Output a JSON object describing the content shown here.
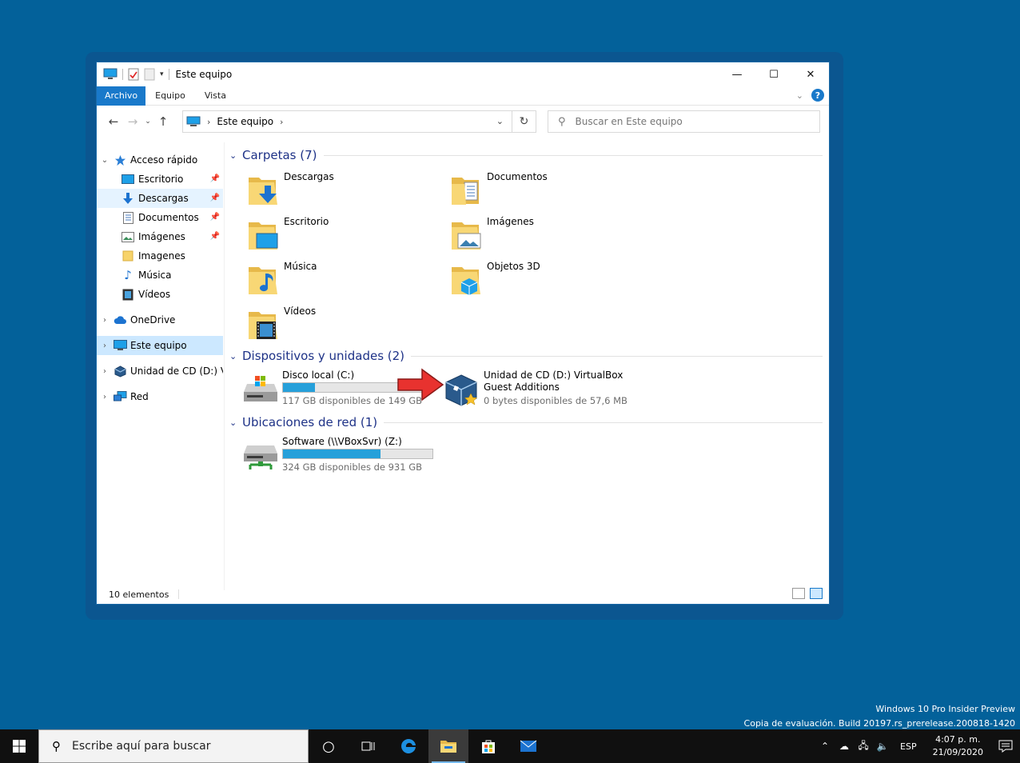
{
  "window": {
    "title": "Este equipo",
    "controls": {
      "minimize": "—",
      "maximize": "☐",
      "close": "✕"
    }
  },
  "ribbon": {
    "tabs": [
      {
        "label": "Archivo",
        "active": true
      },
      {
        "label": "Equipo",
        "active": false
      },
      {
        "label": "Vista",
        "active": false
      }
    ],
    "help": "?"
  },
  "address": {
    "location": "Este equipo",
    "separator": "›"
  },
  "search": {
    "placeholder": "Buscar en Este equipo"
  },
  "sidebar": {
    "items": [
      {
        "label": "Acceso rápido",
        "icon": "star-icon",
        "expander": "⌄",
        "pinned": false
      },
      {
        "label": "Escritorio",
        "icon": "desktop-icon",
        "expander": "",
        "pinned": true
      },
      {
        "label": "Descargas",
        "icon": "download-icon",
        "expander": "",
        "pinned": true
      },
      {
        "label": "Documentos",
        "icon": "document-icon",
        "expander": "",
        "pinned": true
      },
      {
        "label": "Imágenes",
        "icon": "pictures-icon",
        "expander": "",
        "pinned": true
      },
      {
        "label": "Imagenes",
        "icon": "folder-icon",
        "expander": "",
        "pinned": false
      },
      {
        "label": "Música",
        "icon": "music-icon",
        "expander": "",
        "pinned": false
      },
      {
        "label": "Vídeos",
        "icon": "video-icon",
        "expander": "",
        "pinned": false
      },
      {
        "label": "OneDrive",
        "icon": "cloud-icon",
        "expander": "›",
        "pinned": false
      },
      {
        "label": "Este equipo",
        "icon": "computer-icon",
        "expander": "›",
        "pinned": false
      },
      {
        "label": "Unidad de CD (D:) VirtualBox Guest Additions",
        "icon": "cd-drive-icon",
        "expander": "›",
        "pinned": false
      },
      {
        "label": "Red",
        "icon": "network-icon",
        "expander": "›",
        "pinned": false
      }
    ]
  },
  "groups": {
    "folders": {
      "title": "Carpetas (7)",
      "items": [
        {
          "label": "Descargas",
          "icon": "downloads-folder-icon"
        },
        {
          "label": "Documentos",
          "icon": "documents-folder-icon"
        },
        {
          "label": "Escritorio",
          "icon": "desktop-folder-icon"
        },
        {
          "label": "Imágenes",
          "icon": "pictures-folder-icon"
        },
        {
          "label": "Música",
          "icon": "music-folder-icon"
        },
        {
          "label": "Objetos 3D",
          "icon": "3d-objects-folder-icon"
        },
        {
          "label": "Vídeos",
          "icon": "videos-folder-icon"
        }
      ]
    },
    "devices": {
      "title": "Dispositivos y unidades (2)",
      "items": [
        {
          "label": "Disco local (C:)",
          "free": "117 GB disponibles de 149 GB",
          "used_fraction": 0.215,
          "icon": "hard-drive-icon"
        },
        {
          "label": "Unidad de CD (D:) VirtualBox Guest Additions",
          "free": "0 bytes disponibles de 57,6 MB",
          "icon": "virtualbox-cd-icon"
        }
      ]
    },
    "network": {
      "title": "Ubicaciones de red (1)",
      "items": [
        {
          "label": "Software (\\\\VBoxSvr) (Z:)",
          "free": "324 GB disponibles de 931 GB",
          "used_fraction": 0.652,
          "icon": "network-drive-icon"
        }
      ]
    }
  },
  "status": {
    "count": "10 elementos"
  },
  "watermark": {
    "line1": "Windows 10 Pro Insider Preview",
    "line2": "Copia de evaluación. Build 20197.rs_prerelease.200818-1420"
  },
  "taskbar": {
    "search_placeholder": "Escribe aquí para buscar",
    "language": "ESP",
    "time": "4:07 p. m.",
    "date": "21/09/2020"
  },
  "colors": {
    "desktop": "#03619a",
    "accent": "#1979ca",
    "group_header": "#1e3287",
    "drive_bar": "#26a0da",
    "selection": "#cce8ff"
  }
}
